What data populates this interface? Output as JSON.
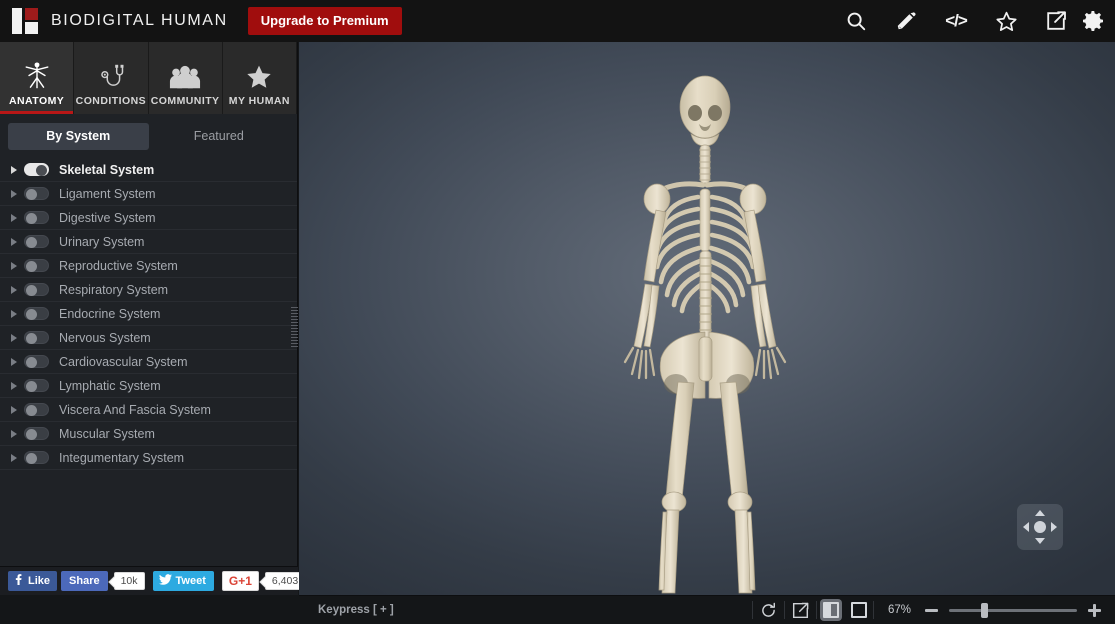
{
  "header": {
    "brand": "BIODIGITAL HUMAN",
    "upgrade_label": "Upgrade to Premium",
    "icons": [
      {
        "name": "search-icon",
        "label": "Search"
      },
      {
        "name": "pencil-icon",
        "label": "Annotate"
      },
      {
        "name": "code-icon",
        "label": "</>"
      },
      {
        "name": "star-icon",
        "label": "Favorite"
      },
      {
        "name": "share-icon",
        "label": "Share"
      },
      {
        "name": "gear-icon",
        "label": "Settings"
      }
    ]
  },
  "nav_tabs": [
    {
      "label": "ANATOMY",
      "icon": "vitruvian-man-icon",
      "active": true
    },
    {
      "label": "CONDITIONS",
      "icon": "stethoscope-icon",
      "active": false
    },
    {
      "label": "COMMUNITY",
      "icon": "people-icon",
      "active": false
    },
    {
      "label": "MY HUMAN",
      "icon": "star-icon",
      "active": false
    }
  ],
  "segmented_tabs": [
    {
      "label": "By System",
      "active": true
    },
    {
      "label": "Featured",
      "active": false
    }
  ],
  "systems": [
    {
      "label": "Skeletal System",
      "on": true
    },
    {
      "label": "Ligament System",
      "on": false
    },
    {
      "label": "Digestive System",
      "on": false
    },
    {
      "label": "Urinary System",
      "on": false
    },
    {
      "label": "Reproductive System",
      "on": false
    },
    {
      "label": "Respiratory System",
      "on": false
    },
    {
      "label": "Endocrine System",
      "on": false
    },
    {
      "label": "Nervous System",
      "on": false
    },
    {
      "label": "Cardiovascular System",
      "on": false
    },
    {
      "label": "Lymphatic System",
      "on": false
    },
    {
      "label": "Viscera And Fascia System",
      "on": false
    },
    {
      "label": "Muscular System",
      "on": false
    },
    {
      "label": "Integumentary System",
      "on": false
    }
  ],
  "social": {
    "fb_like": "Like",
    "fb_share": "Share",
    "fb_count": "10k",
    "tweet": "Tweet",
    "gplus": "G+1",
    "gplus_count": "6,403"
  },
  "bottom_bar": {
    "keypress": "Keypress [ + ]",
    "zoom_percent": "67%",
    "refresh_icon": "refresh-icon",
    "popout_icon": "popout-icon",
    "minus_label": "−",
    "plus_label": "+"
  },
  "viewport": {
    "model": "Skeletal System — full human skeleton, anterior view",
    "navpad": "navigation-pad"
  },
  "colors": {
    "brand_red": "#a00d0d",
    "accent_red": "#b81717",
    "header_bg": "#131313",
    "sidebar_bg": "#1f2226",
    "facebook_blue": "#3b5998",
    "twitter_blue": "#2daae1",
    "google_red": "#db4437"
  }
}
